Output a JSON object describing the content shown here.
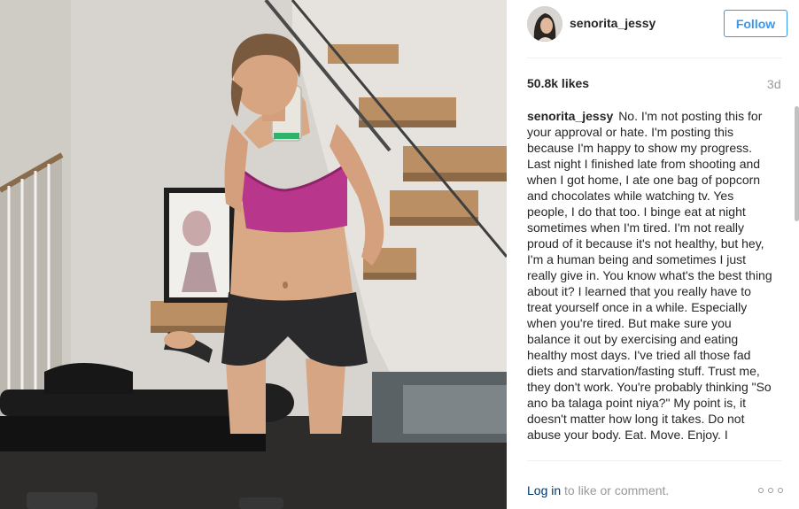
{
  "post": {
    "photo_description_icon": "selfie-photo",
    "username": "senorita_jessy",
    "follow_label": "Follow",
    "likes": "50.8k likes",
    "timestamp": "3d",
    "caption_user": "senorita_jessy",
    "caption_text": "No. I'm not posting this for your approval or hate. I'm posting this because I'm happy to show my progress. Last night I finished late from shooting and when I got home, I ate one bag of popcorn and chocolates while watching tv. Yes people, I do that too. I binge eat at night sometimes when I'm tired. I'm not really proud of it because it's not healthy, but hey, I'm a human being and sometimes I just really give in. You know what's the best thing about it? I learned that you really have to treat yourself once in a while. Especially when you're tired. But make sure you balance it out by exercising and eating healthy most days. I've tried all those fad diets and starvation/fasting stuff. Trust me, they don't work. You're probably thinking \"So ano ba talaga point niya?\" My point is, it doesn't matter how long it takes. Do not abuse your body. Eat. Move. Enjoy. I",
    "login_link": "Log in",
    "login_rest": " to like or comment."
  },
  "colors": {
    "accent": "#3897f0",
    "link": "#003569",
    "muted": "#999999",
    "text": "#262626"
  },
  "icons": {
    "more": "more-options-icon"
  }
}
